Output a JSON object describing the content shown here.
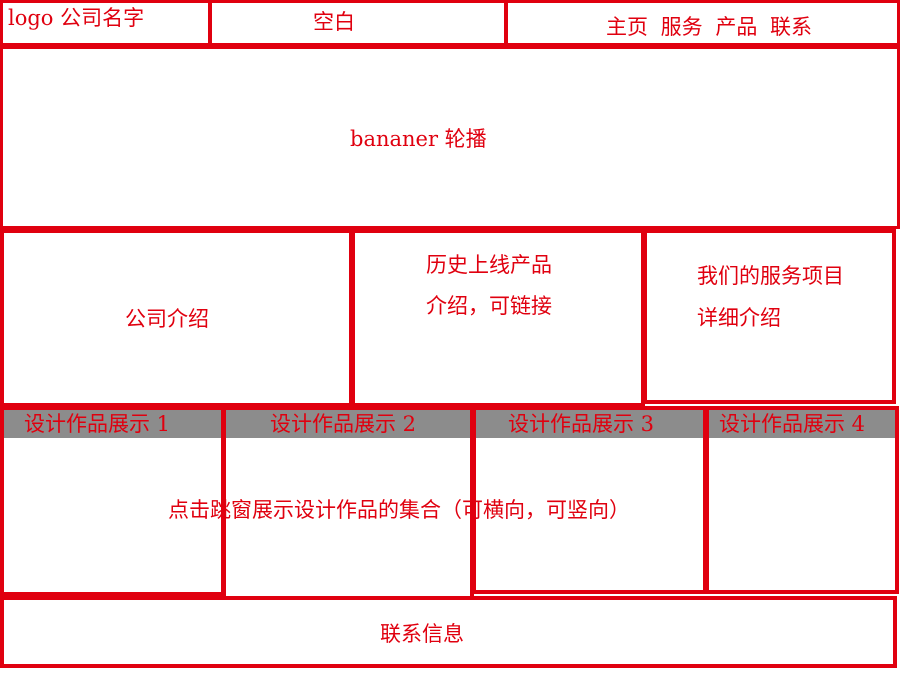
{
  "header": {
    "logo_text": "logo 公司名字",
    "blank_text": "空白",
    "nav_text": "主页 服务 产品 联系"
  },
  "banner": {
    "text": "bananer 轮播"
  },
  "info": {
    "company_intro": "公司介绍",
    "history_line1": "历史上线产品",
    "history_line2": "介绍，可链接",
    "services_line1": "我们的服务项目",
    "services_line2": "详细介绍"
  },
  "showcase": {
    "items": [
      {
        "label": "设计作品展示 1"
      },
      {
        "label": "设计作品展示 2"
      },
      {
        "label": "设计作品展示 3"
      },
      {
        "label": "设计作品展示 4"
      }
    ],
    "note": "点击跳窗展示设计作品的集合（可横向，可竖向）"
  },
  "footer": {
    "text": "联系信息"
  },
  "colors": {
    "border": "#e0000f",
    "bar": "#8c8c8c",
    "background": "#ffffff"
  }
}
